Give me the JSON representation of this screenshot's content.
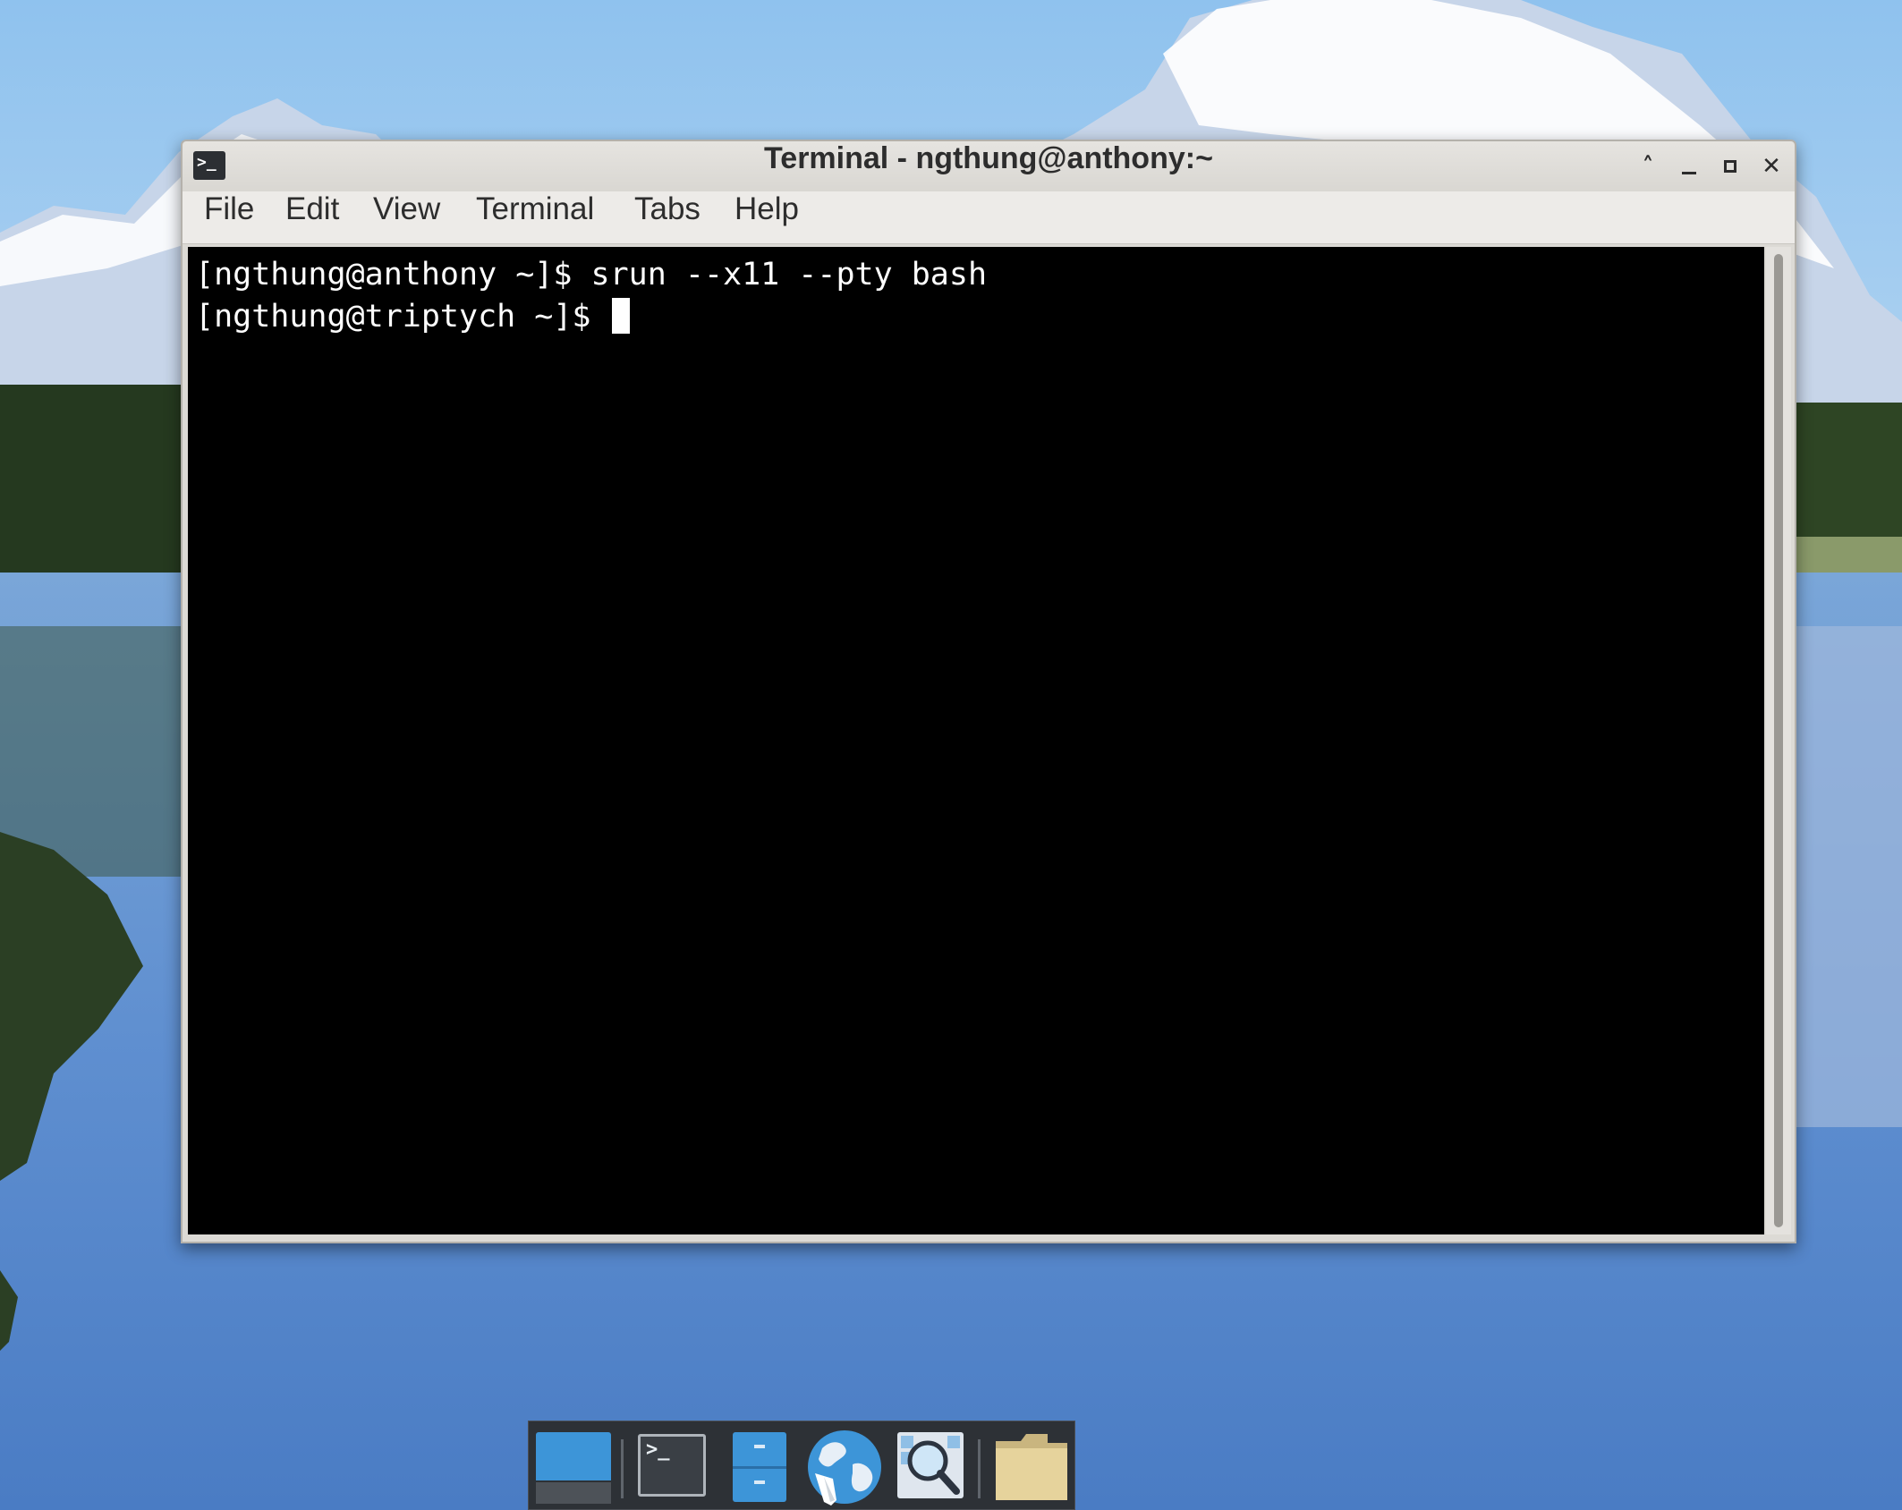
{
  "window": {
    "title": "Terminal - ngthung@anthony:~",
    "icon": "terminal-app-icon",
    "controls": [
      "shade-icon",
      "minimize-icon",
      "maximize-icon",
      "close-icon"
    ]
  },
  "menu": [
    "File",
    "Edit",
    "View",
    "Terminal",
    "Tabs",
    "Help"
  ],
  "terminal": {
    "line1": "[ngthung@anthony ~]$ srun --x11 --pty bash",
    "line2": "[ngthung@triptych ~]$ "
  },
  "dock": {
    "items": [
      "show-desktop-icon",
      "terminal-icon",
      "file-manager-icon",
      "web-browser-icon",
      "app-finder-icon",
      "home-folder-icon"
    ]
  },
  "colors": {
    "terminal_bg": "#000000",
    "terminal_fg": "#ffffff",
    "titlebar": "#dcdad5",
    "dock_bg": "#2d3136",
    "accent_blue": "#3d95d8"
  }
}
